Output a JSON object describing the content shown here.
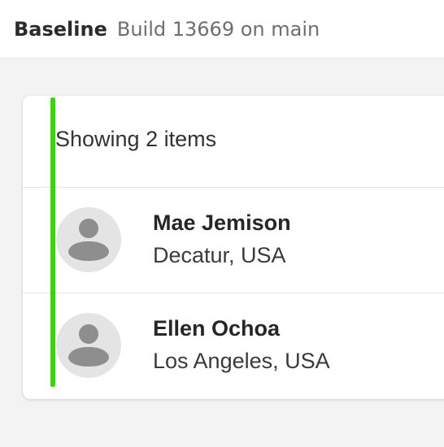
{
  "header": {
    "title": "Baseline",
    "build": "Build 13669 on main"
  },
  "list": {
    "count_label": "Showing 2 items",
    "accent_color": "#3cd412",
    "items": [
      {
        "name": "Mae Jemison",
        "location": "Decatur, USA",
        "avatar_icon": "person-icon"
      },
      {
        "name": "Ellen Ochoa",
        "location": "Los Angeles, USA",
        "avatar_icon": "person-icon"
      }
    ]
  }
}
